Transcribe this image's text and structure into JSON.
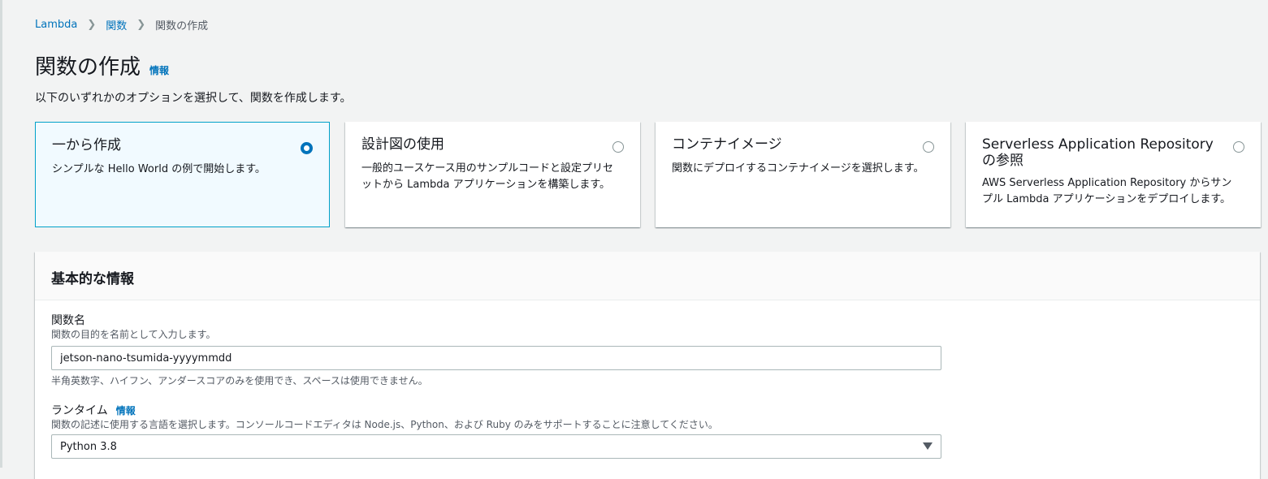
{
  "breadcrumb": {
    "items": [
      "Lambda",
      "関数",
      "関数の作成"
    ]
  },
  "page": {
    "title": "関数の作成",
    "info_link": "情報",
    "subtitle": "以下のいずれかのオプションを選択して、関数を作成します。"
  },
  "options": [
    {
      "title": "一から作成",
      "description": "シンプルな Hello World の例で開始します。",
      "selected": true
    },
    {
      "title": "設計図の使用",
      "description": "一般的ユースケース用のサンプルコードと設定プリセットから Lambda アプリケーションを構築します。",
      "selected": false
    },
    {
      "title": "コンテナイメージ",
      "description": "関数にデプロイするコンテナイメージを選択します。",
      "selected": false
    },
    {
      "title": "Serverless Application Repository の参照",
      "description": "AWS Serverless Application Repository からサンプル Lambda アプリケーションをデプロイします。",
      "selected": false
    }
  ],
  "basic_info": {
    "title": "基本的な情報",
    "function_name": {
      "label": "関数名",
      "description": "関数の目的を名前として入力します。",
      "value": "jetson-nano-tsumida-yyyymmdd",
      "hint": "半角英数字、ハイフン、アンダースコアのみを使用でき、スペースは使用できません。"
    },
    "runtime": {
      "label": "ランタイム",
      "info_link": "情報",
      "description": "関数の記述に使用する言語を選択します。コンソールコードエディタは Node.js、Python、および Ruby のみをサポートすることに注意してください。",
      "value": "Python 3.8"
    }
  },
  "colors": {
    "link": "#0073bb",
    "selected_border": "#00a1c9",
    "selected_bg": "#f1faff",
    "background": "#f2f3f3"
  }
}
